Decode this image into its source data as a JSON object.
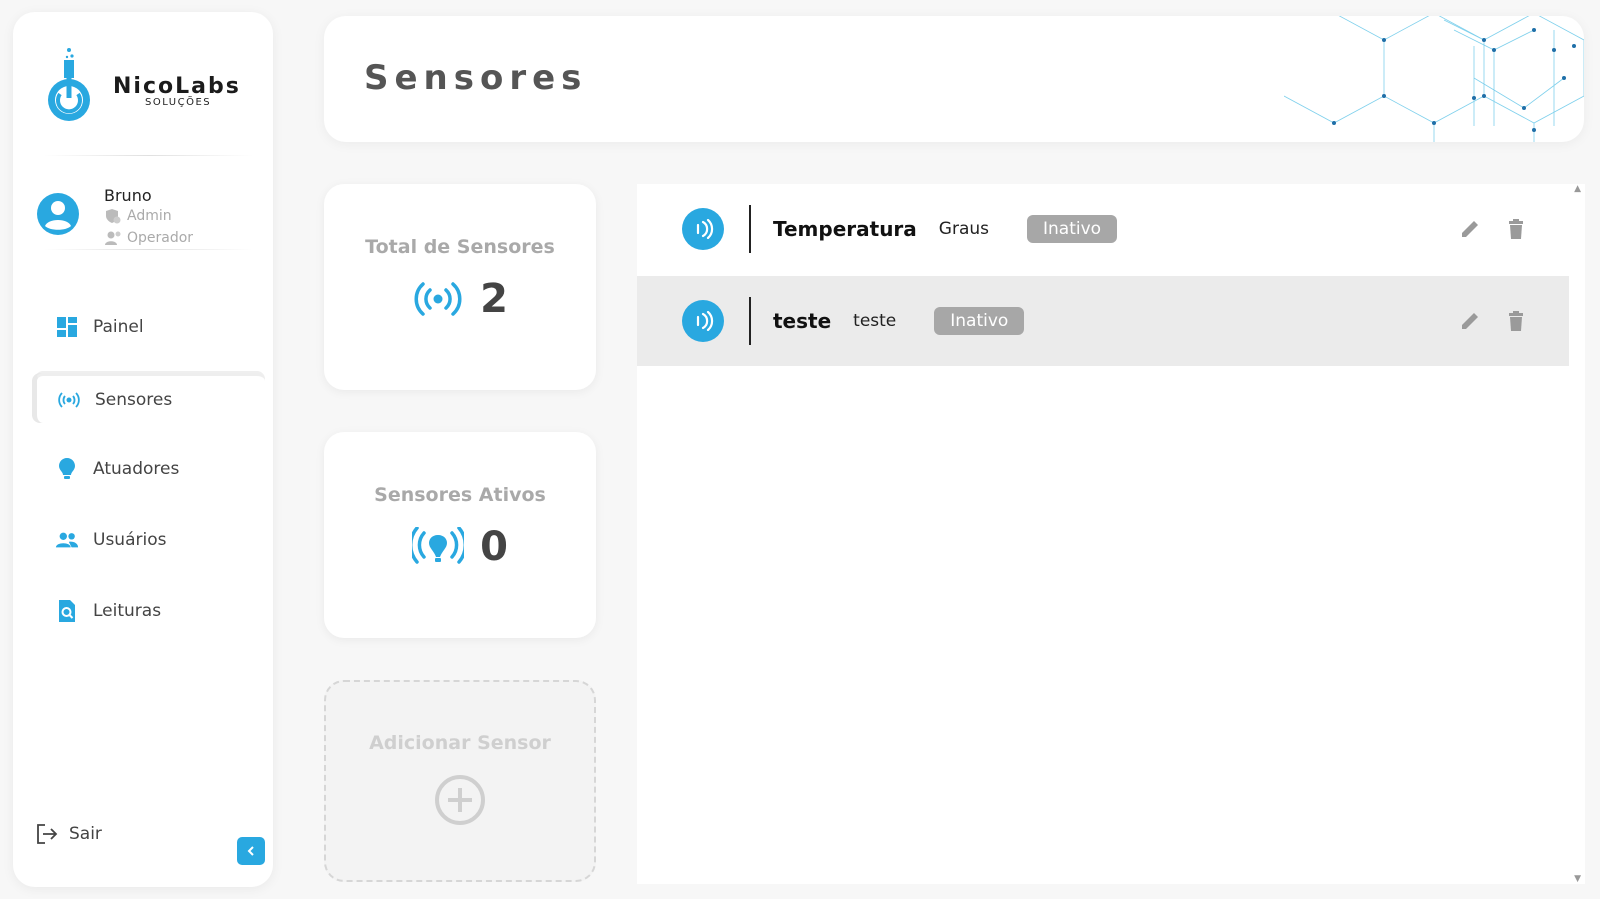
{
  "brand": {
    "name": "NicoLabs",
    "subtitle": "SOLUÇÕES",
    "accent": "#29a8e0"
  },
  "user": {
    "name": "Bruno",
    "roles": [
      "Admin",
      "Operador"
    ]
  },
  "sidebar": {
    "items": [
      {
        "label": "Painel",
        "icon": "dashboard-icon"
      },
      {
        "label": "Sensores",
        "icon": "sensor-icon",
        "active": true
      },
      {
        "label": "Atuadores",
        "icon": "bulb-icon"
      },
      {
        "label": "Usuários",
        "icon": "users-icon"
      },
      {
        "label": "Leituras",
        "icon": "readings-icon"
      }
    ],
    "logout_label": "Sair"
  },
  "header": {
    "title": "Sensores"
  },
  "stats": {
    "total": {
      "title": "Total de Sensores",
      "value": "2"
    },
    "active": {
      "title": "Sensores Ativos",
      "value": "0"
    },
    "add": {
      "title": "Adicionar Sensor"
    }
  },
  "sensors": [
    {
      "name": "Temperatura",
      "unit": "Graus",
      "status": "Inativo"
    },
    {
      "name": "teste",
      "unit": "teste",
      "status": "Inativo"
    }
  ]
}
